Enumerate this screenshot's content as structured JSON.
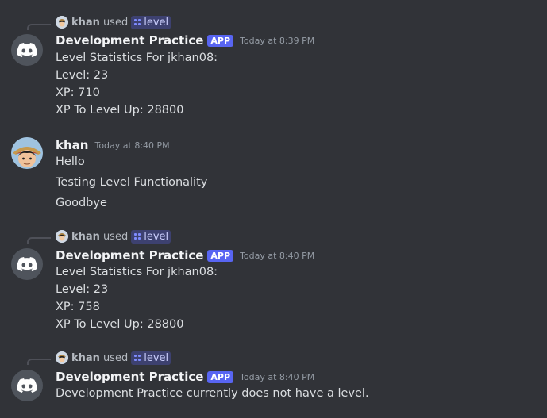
{
  "colors": {
    "background": "#313338",
    "blurple": "#5865f2",
    "text": "#dbdee1",
    "muted": "#949ba4"
  },
  "messages": [
    {
      "command": {
        "user": "khan",
        "used": "used",
        "name": "level"
      },
      "author": "Development Practice",
      "badge": "APP",
      "time": "Today at 8:39 PM",
      "lines": [
        "Level Statistics For jkhan08:",
        "Level: 23",
        "XP: 710",
        "XP To Level Up: 28800"
      ]
    },
    {
      "author": "khan",
      "time": "Today at 8:40 PM",
      "lines": [
        "Hello",
        "Testing Level Functionality",
        "Goodbye"
      ]
    },
    {
      "command": {
        "user": "khan",
        "used": "used",
        "name": "level"
      },
      "author": "Development Practice",
      "badge": "APP",
      "time": "Today at 8:40 PM",
      "lines": [
        "Level Statistics For jkhan08:",
        "Level: 23",
        "XP: 758",
        "XP To Level Up: 28800"
      ]
    },
    {
      "command": {
        "user": "khan",
        "used": "used",
        "name": "level"
      },
      "author": "Development Practice",
      "badge": "APP",
      "time": "Today at 8:40 PM",
      "lines": [
        "Development Practice currently does not have a level."
      ]
    }
  ]
}
